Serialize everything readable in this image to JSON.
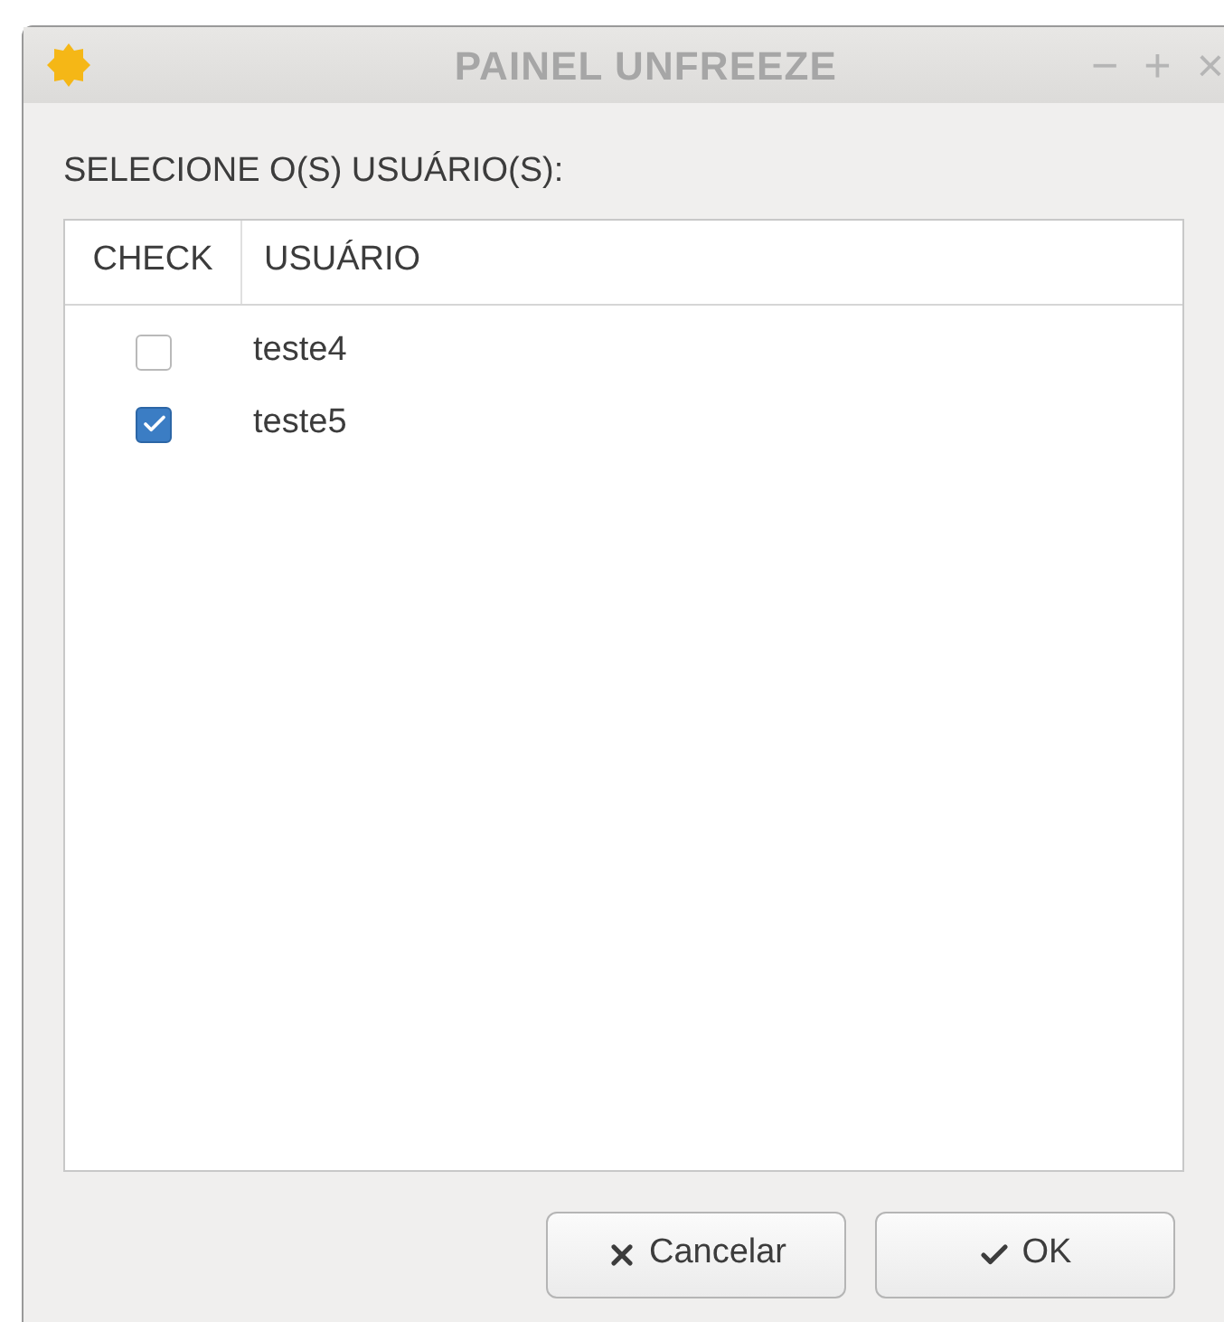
{
  "window": {
    "title": "PAINEL UNFREEZE",
    "controls": [
      "−",
      "+",
      "×"
    ]
  },
  "prompt": "SELECIONE O(S) USUÁRIO(S):",
  "table": {
    "columns": [
      "CHECK",
      "USUÁRIO"
    ],
    "rows": [
      {
        "user": "teste4",
        "checked": false
      },
      {
        "user": "teste5",
        "checked": true
      }
    ]
  },
  "buttons": [
    {
      "kind": "cancel",
      "label": "Cancelar"
    },
    {
      "kind": "ok",
      "label": "OK"
    }
  ]
}
